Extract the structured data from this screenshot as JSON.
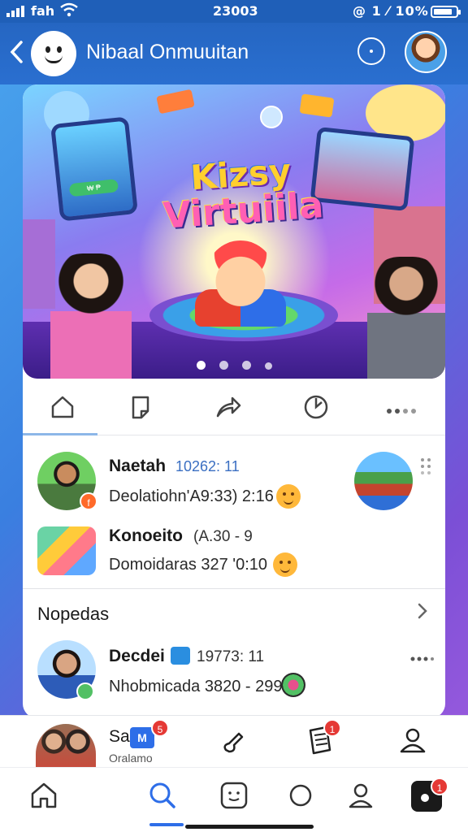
{
  "status_bar": {
    "carrier": "fah",
    "time": "23003",
    "right_text": "@ 1 ⁄ 10%",
    "battery_level": 0.85
  },
  "header": {
    "title": "Nibaal Onmuuitan"
  },
  "banner": {
    "title_line1": "Kizsy",
    "title_line2": "Virtuiila",
    "tablet_label": "₩ ₱",
    "slide_count": 4,
    "active_slide": 0
  },
  "feed": [
    {
      "name": "Naetah",
      "meta": "10262: 11",
      "subtitle": "Deolatiohn'A9:33) 2:16"
    },
    {
      "name": "Konoeito",
      "meta": "(A.30 - 9",
      "subtitle": "Domoidaras 327 '0:10"
    }
  ],
  "section": {
    "title": "Nopedas",
    "rows": [
      {
        "name": "Decdei",
        "meta": "19773: 11",
        "subtitle": "Nhobmicada 3820 - 299"
      }
    ]
  },
  "mini_bar": {
    "title": "Sa",
    "subtitle": "Oralamo",
    "tag": "M",
    "badge_count": "5",
    "doc_badge": "1"
  },
  "tab_bar": {
    "active_tab": "search",
    "record_badge": "1"
  },
  "colors": {
    "primary": "#2566c2",
    "accent": "#2e6ee8",
    "badge": "#e53935"
  }
}
